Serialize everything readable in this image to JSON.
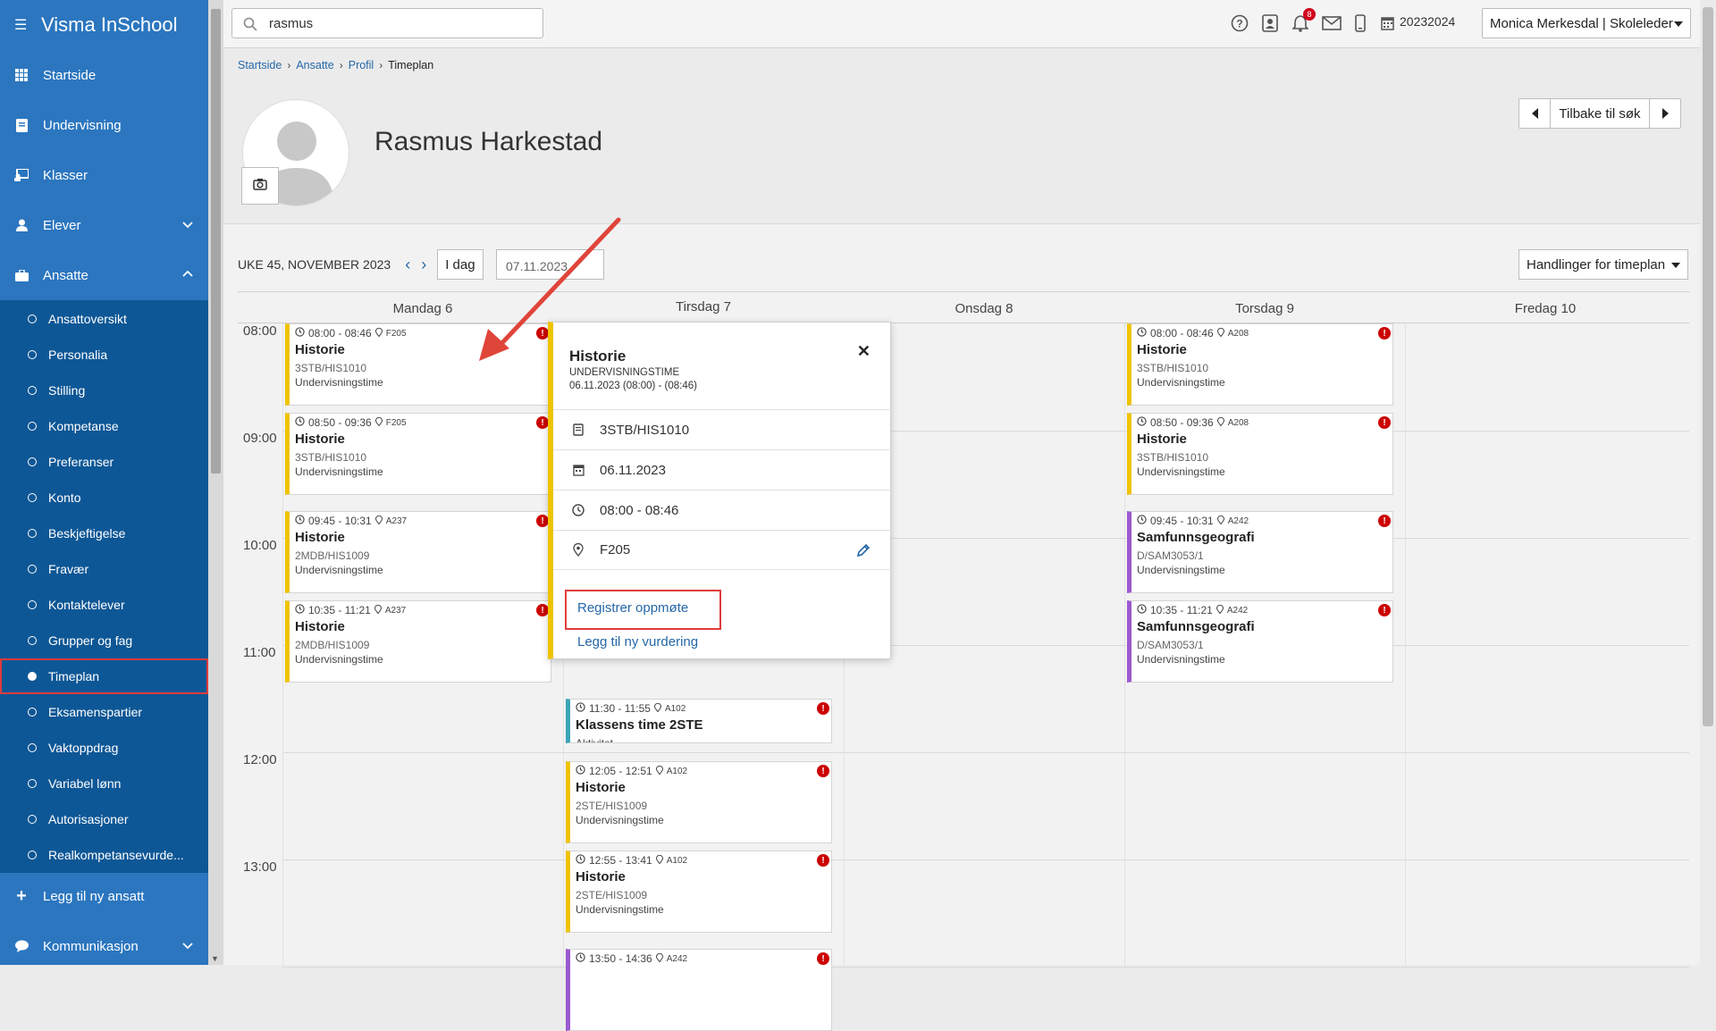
{
  "app": {
    "title": "Visma InSchool"
  },
  "sidebar": {
    "items": [
      {
        "label": "Startside",
        "icon": "grid-icon"
      },
      {
        "label": "Undervisning",
        "icon": "book-icon"
      },
      {
        "label": "Klasser",
        "icon": "board-icon"
      },
      {
        "label": "Elever",
        "icon": "students-icon"
      },
      {
        "label": "Ansatte",
        "icon": "briefcase-icon"
      }
    ],
    "ansatte_sub": [
      {
        "label": "Ansattoversikt"
      },
      {
        "label": "Personalia"
      },
      {
        "label": "Stilling"
      },
      {
        "label": "Kompetanse"
      },
      {
        "label": "Preferanser"
      },
      {
        "label": "Konto"
      },
      {
        "label": "Beskjeftigelse"
      },
      {
        "label": "Fravær"
      },
      {
        "label": "Kontaktelever"
      },
      {
        "label": "Grupper og fag"
      },
      {
        "label": "Timeplan",
        "active": true
      },
      {
        "label": "Eksamenspartier"
      },
      {
        "label": "Vaktoppdrag"
      },
      {
        "label": "Variabel lønn"
      },
      {
        "label": "Autorisasjoner"
      },
      {
        "label": "Realkompetansevurde..."
      }
    ],
    "add_employee": "Legg til ny ansatt",
    "kommunikasjon": "Kommunikasjon"
  },
  "topbar": {
    "search_value": "rasmus",
    "notifications_count": "8",
    "school_year": "20232024",
    "user": "Monica Merkesdal | Skoleleder"
  },
  "breadcrumb": {
    "items": [
      "Startside",
      "Ansatte",
      "Profil"
    ],
    "current": "Timeplan"
  },
  "profile": {
    "name": "Rasmus Harkestad",
    "back_label": "Tilbake til søk"
  },
  "calendar": {
    "week_label": "UKE 45, NOVEMBER 2023",
    "today_label": "I dag",
    "date_value": "07.11.2023",
    "actions_label": "Handlinger for timeplan",
    "days": [
      "Mandag 6",
      "Tirsdag 7",
      "Onsdag 8",
      "Torsdag 9",
      "Fredag 10"
    ],
    "hours": [
      "08:00",
      "09:00",
      "10:00",
      "11:00",
      "12:00",
      "13:00"
    ],
    "events": [
      {
        "day": 0,
        "start": "08:00",
        "end": "08:46",
        "time": "08:00 - 08:46",
        "room": "F205",
        "name": "Historie",
        "class": "3STB/HIS1010",
        "type": "Undervisningstime",
        "color": "yellow"
      },
      {
        "day": 0,
        "start": "08:50",
        "end": "09:36",
        "time": "08:50 - 09:36",
        "room": "F205",
        "name": "Historie",
        "class": "3STB/HIS1010",
        "type": "Undervisningstime",
        "color": "yellow"
      },
      {
        "day": 0,
        "start": "09:45",
        "end": "10:31",
        "time": "09:45 - 10:31",
        "room": "A237",
        "name": "Historie",
        "class": "2MDB/HIS1009",
        "type": "Undervisningstime",
        "color": "yellow"
      },
      {
        "day": 0,
        "start": "10:35",
        "end": "11:21",
        "time": "10:35 - 11:21",
        "room": "A237",
        "name": "Historie",
        "class": "2MDB/HIS1009",
        "type": "Undervisningstime",
        "color": "yellow"
      },
      {
        "day": 1,
        "start": "11:30",
        "end": "11:55",
        "time": "11:30 - 11:55",
        "room": "A102",
        "name": "Klassens time 2STE",
        "class": "",
        "type": "Aktivitet",
        "color": "teal"
      },
      {
        "day": 1,
        "start": "12:05",
        "end": "12:51",
        "time": "12:05 - 12:51",
        "room": "A102",
        "name": "Historie",
        "class": "2STE/HIS1009",
        "type": "Undervisningstime",
        "color": "yellow"
      },
      {
        "day": 1,
        "start": "12:55",
        "end": "13:41",
        "time": "12:55 - 13:41",
        "room": "A102",
        "name": "Historie",
        "class": "2STE/HIS1009",
        "type": "Undervisningstime",
        "color": "yellow"
      },
      {
        "day": 1,
        "start": "13:50",
        "end": "14:36",
        "time": "13:50 - 14:36",
        "room": "A242",
        "name": "",
        "class": "",
        "type": "",
        "color": "purple"
      },
      {
        "day": 3,
        "start": "08:00",
        "end": "08:46",
        "time": "08:00 - 08:46",
        "room": "A208",
        "name": "Historie",
        "class": "3STB/HIS1010",
        "type": "Undervisningstime",
        "color": "yellow"
      },
      {
        "day": 3,
        "start": "08:50",
        "end": "09:36",
        "time": "08:50 - 09:36",
        "room": "A208",
        "name": "Historie",
        "class": "3STB/HIS1010",
        "type": "Undervisningstime",
        "color": "yellow"
      },
      {
        "day": 3,
        "start": "09:45",
        "end": "10:31",
        "time": "09:45 - 10:31",
        "room": "A242",
        "name": "Samfunnsgeografi",
        "class": "D/SAM3053/1",
        "type": "Undervisningstime",
        "color": "purple"
      },
      {
        "day": 3,
        "start": "10:35",
        "end": "11:21",
        "time": "10:35 - 11:21",
        "room": "A242",
        "name": "Samfunnsgeografi",
        "class": "D/SAM3053/1",
        "type": "Undervisningstime",
        "color": "purple"
      }
    ]
  },
  "popup": {
    "title": "Historie",
    "subtitle": "UNDERVISNINGSTIME",
    "datetime": "06.11.2023 (08:00) - (08:46)",
    "group": "3STB/HIS1010",
    "date": "06.11.2023",
    "time": "08:00 - 08:46",
    "room": "F205",
    "register_attendance": "Registrer oppmøte",
    "add_assessment": "Legg til ny vurdering"
  },
  "colors": {
    "sidebar": "#2b76bf",
    "sidebar_sub": "#0e5796",
    "accent": "#2567a8",
    "yellow": "#f0c300",
    "purple": "#9b59d0",
    "teal": "#3aa6b9",
    "highlight": "#e03b3b"
  }
}
